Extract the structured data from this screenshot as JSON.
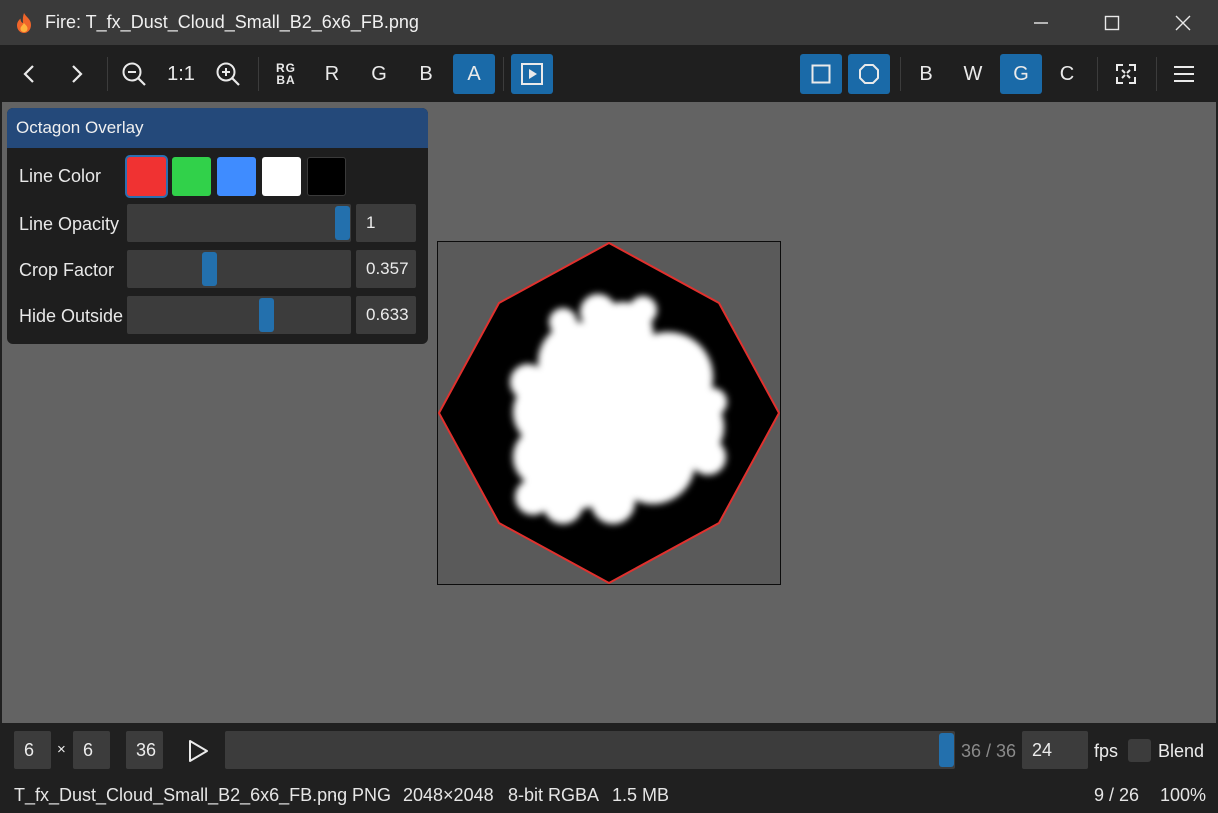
{
  "window": {
    "title": "Fire: T_fx_Dust_Cloud_Small_B2_6x6_FB.png",
    "app_icon": "flame-icon",
    "controls": [
      "minimize-icon",
      "maximize-icon",
      "close-icon"
    ]
  },
  "toolbar": {
    "back_icon": "chevron-left-icon",
    "forward_icon": "chevron-right-icon",
    "zoom_out_icon": "zoom-out-icon",
    "zoom_reset_label": "1:1",
    "zoom_in_icon": "zoom-in-icon",
    "channel_rgba_top": "RG",
    "channel_rgba_bottom": "BA",
    "channel_r": "R",
    "channel_g": "G",
    "channel_b": "B",
    "channel_a": "A",
    "play_overlay_icon": "play-square-icon",
    "square_icon": "square-icon",
    "octagon_icon": "circle-icon",
    "bg_b": "B",
    "bg_w": "W",
    "bg_g": "G",
    "bg_c": "C",
    "fit_icon": "fit-screen-icon",
    "menu_icon": "hamburger-menu-icon",
    "active_color": "#1a6aa8"
  },
  "overlay_panel": {
    "title": "Octagon Overlay",
    "line_color_label": "Line Color",
    "swatches": [
      "#f03232",
      "#31d14a",
      "#3f8cff",
      "#ffffff",
      "#000000"
    ],
    "selected_swatch": "#f03232",
    "line_opacity_label": "Line Opacity",
    "line_opacity_value": "1",
    "line_opacity_fraction": 1.0,
    "crop_factor_label": "Crop Factor",
    "crop_factor_value": "0.357",
    "crop_factor_fraction": 0.357,
    "hide_outside_label": "Hide Outside",
    "hide_outside_value": "0.633",
    "hide_outside_fraction": 0.633
  },
  "viewer": {
    "octagon_color": "#e0312e"
  },
  "playback": {
    "cols": "6",
    "times": "×",
    "rows": "6",
    "frames": "36",
    "play_icon": "play-icon",
    "frame_counter": "36 / 36",
    "frame_fraction": 1.0,
    "fps_value": "24",
    "fps_label": "fps",
    "blend_label": "Blend",
    "blend_checked": false
  },
  "status": {
    "filename": "T_fx_Dust_Cloud_Small_B2_6x6_FB.png",
    "dot": "·",
    "format": "PNG",
    "dimensions": "2048×2048",
    "bit_depth": "8-bit RGBA",
    "file_size": "1.5 MB",
    "page": "9 / 26",
    "zoom": "100%"
  }
}
